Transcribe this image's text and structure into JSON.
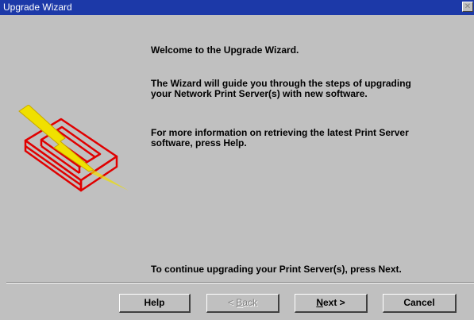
{
  "window": {
    "title": "Upgrade Wizard"
  },
  "content": {
    "welcome": "Welcome to the  Upgrade Wizard.",
    "guide": "The Wizard will guide you through the steps of upgrading\nyour  Network Print Server(s) with new software.",
    "info": "For more information on retrieving the latest Print Server\nsoftware, press Help.",
    "continue": "To continue upgrading your Print Server(s), press Next."
  },
  "buttons": {
    "help": "Help",
    "back_prefix": "< ",
    "back_underlined": "B",
    "back_suffix": "ack",
    "next_underlined": "N",
    "next_suffix": "ext >",
    "cancel": "Cancel"
  },
  "icons": {
    "close": "close-icon",
    "illustration": "print-server-upgrade-icon"
  },
  "colors": {
    "titlebar": "#1c39a8",
    "dialog_bg": "#c0c0c0",
    "illustration_red": "#e00000",
    "lightning_yellow": "#f0e000"
  }
}
